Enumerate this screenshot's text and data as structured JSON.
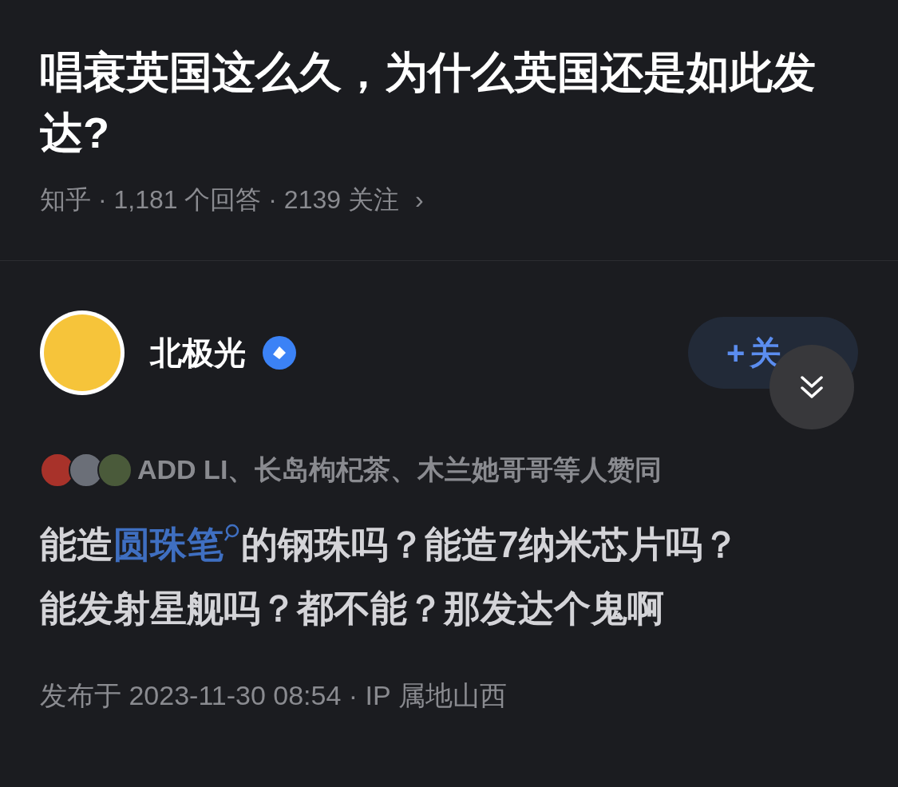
{
  "question": {
    "title": "唱衰英国这么久，为什么英国还是如此发达?",
    "meta": "知乎 · 1,181 个回答 · 2139 关注",
    "chevron": "›"
  },
  "answer": {
    "author": "北极光",
    "verified": true,
    "follow_button": {
      "icon": "+",
      "label": "关"
    },
    "voters": {
      "avatars": [
        {
          "color": "#a8322a"
        },
        {
          "color": "#6b6f78"
        },
        {
          "color": "#4a5a3a"
        }
      ],
      "text": "ADD LI、长岛枸杞茶、木兰她哥哥等人赞同"
    },
    "body": [
      {
        "kind": "text",
        "text": "能造"
      },
      {
        "kind": "link",
        "text": "圆珠笔"
      },
      {
        "kind": "text",
        "text": "的钢珠吗？能造7纳米芯片吗？能发射星舰吗？都不能？那发达个鬼啊"
      }
    ],
    "footer": "发布于 2023-11-30 08:54 · IP 属地山西"
  }
}
